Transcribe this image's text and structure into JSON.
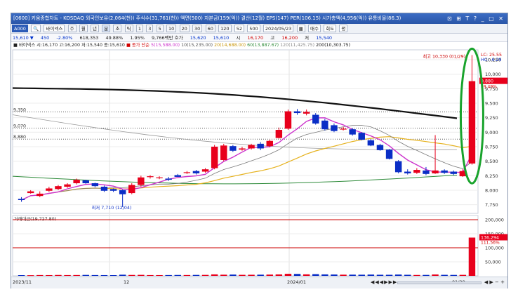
{
  "window": {
    "title": "[0600] 키움종합차트 - KOSDAQ 외국인보유(2,064(천)) 주식수(31,761(천)) 액면(500) 자본금(159(억)) 결산(12월) EPS(147) PER(106.15) 시가총액(4,956(억)) 유통비율(86.3)",
    "controls": "⊡ ⊞ T ? _ ▢ ✕"
  },
  "toolbar": {
    "code": "A000",
    "name": "바이넥스",
    "chart_types": [
      "주",
      "월",
      "년",
      "분",
      "초",
      "틱"
    ],
    "periods": [
      "1",
      "3",
      "5",
      "10",
      "20",
      "30",
      "60",
      "120"
    ],
    "count": "52",
    "count2": "500",
    "date": "2024/05/23",
    "btn_trade": "매수",
    "btn_rotate": "회도",
    "btn_settings": "평"
  },
  "quote": {
    "price": "15,610 ▼",
    "change": "450",
    "change_pct": "-2.80%",
    "volume": "618,353",
    "vol_rate": "49.88%",
    "turnover": "1.95%",
    "amount": "9,766백만 호가",
    "bid": "15,620",
    "ask": "15,610",
    "open_label": "시",
    "open": "16,170",
    "high_label": "고",
    "high": "16,200",
    "low_label": "저",
    "low": "15,540"
  },
  "legend": {
    "stock": "■ 바이넥스 시:16,170 고:16,200 저:15,540 종:15,610",
    "mode": "■ 종가 단순",
    "ma5": "5(15,588.00)",
    "ma10": "10(15,235.00)",
    "ma20": "20(14,688.00)",
    "ma60": "60(13,887.67)",
    "ma120": "120(11,425.75)",
    "ma200": "200(10,303.75)"
  },
  "volume_legend": "거래대금(19,727.80)",
  "annotations": {
    "high": "최고 10,330 (01/29)",
    "low": "최저 7,710 (12/04)",
    "price_flag": "9,880",
    "price_flag_pct": "19.49%",
    "top_right_1": "LC: 25.55",
    "top_right_2": "HC: -6.29",
    "vol_flag_1": "136,294",
    "vol_flag_2": "111.56%"
  },
  "axis": {
    "y_price": [
      "10,250",
      "10,000",
      "9,750",
      "9,500",
      "9,250",
      "9,000",
      "8,750",
      "8,500",
      "8,250",
      "8,000",
      "7,750"
    ],
    "y_left": [
      "9,350",
      "9,070",
      "8,880"
    ],
    "y_volume": [
      "200,000",
      "150,000",
      "100,000",
      "50,000"
    ],
    "x": [
      "2023/11",
      "12",
      "2024/01",
      "01/29"
    ]
  },
  "colors": {
    "up": "#e8001c",
    "down": "#0a2ec6",
    "ma5": "#cc33cc",
    "ma20": "#e6b21e",
    "ma60": "#2e8b3a",
    "ma120": "#9a9a9a",
    "ma200": "#111111",
    "highlight": "#19a32c"
  },
  "chart_data": {
    "type": "candlestick",
    "x": [
      "11/16",
      "11/17",
      "11/20",
      "11/21",
      "11/22",
      "11/23",
      "11/24",
      "11/27",
      "11/28",
      "11/29",
      "11/30",
      "12/01",
      "12/04",
      "12/05",
      "12/06",
      "12/07",
      "12/08",
      "12/11",
      "12/12",
      "12/13",
      "12/14",
      "12/15",
      "12/18",
      "12/19",
      "12/20",
      "12/21",
      "12/22",
      "12/26",
      "12/27",
      "12/28",
      "01/02",
      "01/03",
      "01/04",
      "01/05",
      "01/08",
      "01/09",
      "01/10",
      "01/11",
      "01/12",
      "01/15",
      "01/16",
      "01/17",
      "01/18",
      "01/19",
      "01/22",
      "01/23",
      "01/24",
      "01/25",
      "01/26",
      "01/29"
    ],
    "open": [
      7850,
      7950,
      7900,
      7990,
      8020,
      8060,
      8120,
      8170,
      8120,
      8060,
      8020,
      8000,
      7950,
      8090,
      8230,
      8220,
      8200,
      8260,
      8300,
      8330,
      8320,
      8380,
      8520,
      8760,
      8700,
      8720,
      8800,
      8760,
      8900,
      9060,
      9360,
      9320,
      9300,
      9200,
      9120,
      9060,
      9050,
      8990,
      8860,
      8780,
      8700,
      8500,
      8320,
      8300,
      8340,
      8290,
      8340,
      8320,
      8240,
      8460
    ],
    "close": [
      7830,
      7980,
      7940,
      8030,
      8070,
      8100,
      8180,
      8120,
      8070,
      7990,
      7990,
      7930,
      8090,
      8220,
      8240,
      8220,
      8180,
      8230,
      8310,
      8290,
      8360,
      8750,
      8770,
      8680,
      8720,
      8780,
      8720,
      8850,
      9040,
      9360,
      9330,
      9350,
      9150,
      9050,
      9020,
      9060,
      8960,
      8870,
      8770,
      8690,
      8540,
      8310,
      8290,
      8350,
      8280,
      8340,
      8300,
      8280,
      8330,
      9880
    ],
    "high": [
      7880,
      8000,
      7980,
      8060,
      8090,
      8120,
      8200,
      8180,
      8130,
      8080,
      8030,
      8010,
      8120,
      8250,
      8260,
      8240,
      8230,
      8280,
      8330,
      8350,
      8380,
      8780,
      8800,
      8780,
      8750,
      8800,
      8830,
      8870,
      9080,
      9390,
      9400,
      9390,
      9330,
      9230,
      9150,
      9090,
      9070,
      9000,
      8880,
      8800,
      8710,
      8520,
      8360,
      8380,
      8400,
      8950,
      8360,
      8340,
      8360,
      10330
    ],
    "low": [
      7800,
      7940,
      7880,
      7970,
      8000,
      8040,
      8100,
      8110,
      8050,
      7970,
      7970,
      7710,
      7930,
      8060,
      8200,
      8190,
      8160,
      8230,
      8280,
      8270,
      8300,
      8360,
      8500,
      8660,
      8680,
      8700,
      8690,
      8740,
      8890,
      9040,
      9300,
      9290,
      9130,
      9030,
      9000,
      9030,
      8940,
      8860,
      8760,
      8680,
      8530,
      8290,
      8270,
      8280,
      8260,
      8280,
      8280,
      8260,
      8230,
      8440
    ],
    "volume": [
      2500,
      2200,
      2800,
      2600,
      3100,
      2700,
      2900,
      3300,
      2800,
      2600,
      2500,
      4100,
      3200,
      3500,
      2700,
      2600,
      2800,
      3100,
      2900,
      3300,
      3400,
      5200,
      4100,
      4600,
      3600,
      3900,
      4200,
      4500,
      5100,
      7300,
      6900,
      5400,
      6100,
      5200,
      4800,
      4200,
      4300,
      4100,
      4600,
      3900,
      3800,
      4700,
      3800,
      3100,
      3300,
      4900,
      3600,
      3300,
      3500,
      136294
    ],
    "ylim": [
      7600,
      10420
    ],
    "volume_ylim": [
      0,
      215000
    ]
  }
}
